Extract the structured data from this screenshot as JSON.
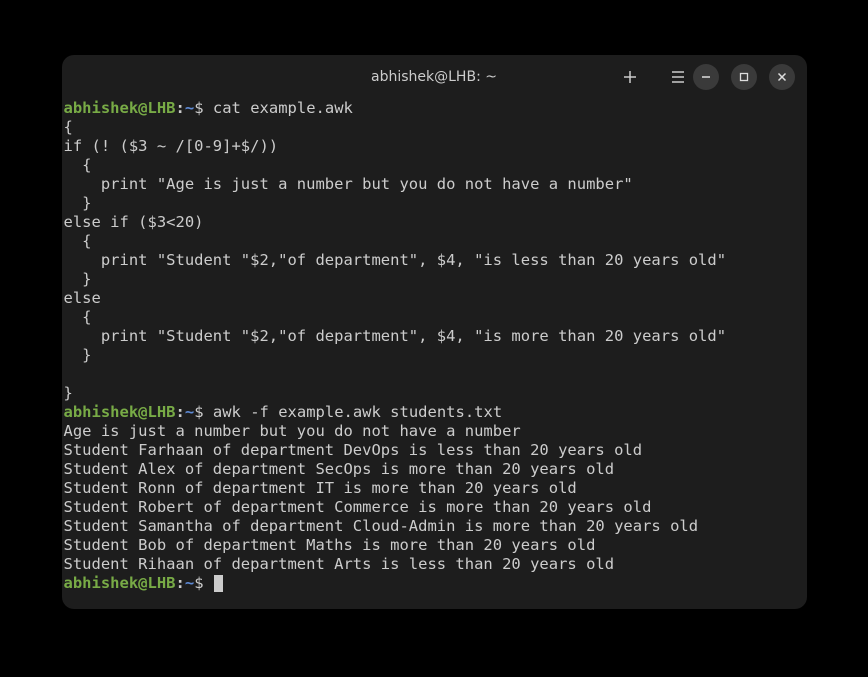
{
  "title": "abhishek@LHB: ~",
  "prompt": {
    "user": "abhishek",
    "at": "@",
    "host": "LHB",
    "colon": ":",
    "path": "~",
    "dollar": "$"
  },
  "commands": {
    "cat": "cat example.awk",
    "awk": "awk -f example.awk students.txt"
  },
  "script_lines": [
    "{",
    "if (! ($3 ~ /[0-9]+$/))",
    "  {",
    "    print \"Age is just a number but you do not have a number\"",
    "  }",
    "else if ($3<20)",
    "  {",
    "    print \"Student \"$2,\"of department\", $4, \"is less than 20 years old\"",
    "  }",
    "else",
    "  {",
    "    print \"Student \"$2,\"of department\", $4, \"is more than 20 years old\"",
    "  }",
    "",
    "}"
  ],
  "output_lines": [
    "Age is just a number but you do not have a number",
    "Student Farhaan of department DevOps is less than 20 years old",
    "Student Alex of department SecOps is more than 20 years old",
    "Student Ronn of department IT is more than 20 years old",
    "Student Robert of department Commerce is more than 20 years old",
    "Student Samantha of department Cloud-Admin is more than 20 years old",
    "Student Bob of department Maths is more than 20 years old",
    "Student Rihaan of department Arts is less than 20 years old"
  ],
  "icons": {
    "new_tab": "+",
    "menu": "≡",
    "minimize": "—",
    "maximize": "▢",
    "close": "✕"
  }
}
